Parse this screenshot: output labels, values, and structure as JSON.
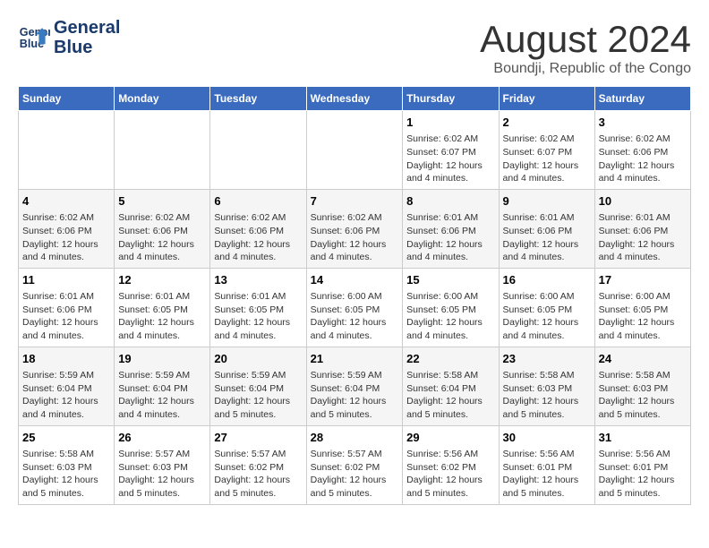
{
  "header": {
    "logo_line1": "General",
    "logo_line2": "Blue",
    "month_title": "August 2024",
    "subtitle": "Boundji, Republic of the Congo"
  },
  "weekdays": [
    "Sunday",
    "Monday",
    "Tuesday",
    "Wednesday",
    "Thursday",
    "Friday",
    "Saturday"
  ],
  "weeks": [
    [
      {
        "day": "",
        "info": ""
      },
      {
        "day": "",
        "info": ""
      },
      {
        "day": "",
        "info": ""
      },
      {
        "day": "",
        "info": ""
      },
      {
        "day": "1",
        "info": "Sunrise: 6:02 AM\nSunset: 6:07 PM\nDaylight: 12 hours\nand 4 minutes."
      },
      {
        "day": "2",
        "info": "Sunrise: 6:02 AM\nSunset: 6:07 PM\nDaylight: 12 hours\nand 4 minutes."
      },
      {
        "day": "3",
        "info": "Sunrise: 6:02 AM\nSunset: 6:06 PM\nDaylight: 12 hours\nand 4 minutes."
      }
    ],
    [
      {
        "day": "4",
        "info": "Sunrise: 6:02 AM\nSunset: 6:06 PM\nDaylight: 12 hours\nand 4 minutes."
      },
      {
        "day": "5",
        "info": "Sunrise: 6:02 AM\nSunset: 6:06 PM\nDaylight: 12 hours\nand 4 minutes."
      },
      {
        "day": "6",
        "info": "Sunrise: 6:02 AM\nSunset: 6:06 PM\nDaylight: 12 hours\nand 4 minutes."
      },
      {
        "day": "7",
        "info": "Sunrise: 6:02 AM\nSunset: 6:06 PM\nDaylight: 12 hours\nand 4 minutes."
      },
      {
        "day": "8",
        "info": "Sunrise: 6:01 AM\nSunset: 6:06 PM\nDaylight: 12 hours\nand 4 minutes."
      },
      {
        "day": "9",
        "info": "Sunrise: 6:01 AM\nSunset: 6:06 PM\nDaylight: 12 hours\nand 4 minutes."
      },
      {
        "day": "10",
        "info": "Sunrise: 6:01 AM\nSunset: 6:06 PM\nDaylight: 12 hours\nand 4 minutes."
      }
    ],
    [
      {
        "day": "11",
        "info": "Sunrise: 6:01 AM\nSunset: 6:06 PM\nDaylight: 12 hours\nand 4 minutes."
      },
      {
        "day": "12",
        "info": "Sunrise: 6:01 AM\nSunset: 6:05 PM\nDaylight: 12 hours\nand 4 minutes."
      },
      {
        "day": "13",
        "info": "Sunrise: 6:01 AM\nSunset: 6:05 PM\nDaylight: 12 hours\nand 4 minutes."
      },
      {
        "day": "14",
        "info": "Sunrise: 6:00 AM\nSunset: 6:05 PM\nDaylight: 12 hours\nand 4 minutes."
      },
      {
        "day": "15",
        "info": "Sunrise: 6:00 AM\nSunset: 6:05 PM\nDaylight: 12 hours\nand 4 minutes."
      },
      {
        "day": "16",
        "info": "Sunrise: 6:00 AM\nSunset: 6:05 PM\nDaylight: 12 hours\nand 4 minutes."
      },
      {
        "day": "17",
        "info": "Sunrise: 6:00 AM\nSunset: 6:05 PM\nDaylight: 12 hours\nand 4 minutes."
      }
    ],
    [
      {
        "day": "18",
        "info": "Sunrise: 5:59 AM\nSunset: 6:04 PM\nDaylight: 12 hours\nand 4 minutes."
      },
      {
        "day": "19",
        "info": "Sunrise: 5:59 AM\nSunset: 6:04 PM\nDaylight: 12 hours\nand 4 minutes."
      },
      {
        "day": "20",
        "info": "Sunrise: 5:59 AM\nSunset: 6:04 PM\nDaylight: 12 hours\nand 5 minutes."
      },
      {
        "day": "21",
        "info": "Sunrise: 5:59 AM\nSunset: 6:04 PM\nDaylight: 12 hours\nand 5 minutes."
      },
      {
        "day": "22",
        "info": "Sunrise: 5:58 AM\nSunset: 6:04 PM\nDaylight: 12 hours\nand 5 minutes."
      },
      {
        "day": "23",
        "info": "Sunrise: 5:58 AM\nSunset: 6:03 PM\nDaylight: 12 hours\nand 5 minutes."
      },
      {
        "day": "24",
        "info": "Sunrise: 5:58 AM\nSunset: 6:03 PM\nDaylight: 12 hours\nand 5 minutes."
      }
    ],
    [
      {
        "day": "25",
        "info": "Sunrise: 5:58 AM\nSunset: 6:03 PM\nDaylight: 12 hours\nand 5 minutes."
      },
      {
        "day": "26",
        "info": "Sunrise: 5:57 AM\nSunset: 6:03 PM\nDaylight: 12 hours\nand 5 minutes."
      },
      {
        "day": "27",
        "info": "Sunrise: 5:57 AM\nSunset: 6:02 PM\nDaylight: 12 hours\nand 5 minutes."
      },
      {
        "day": "28",
        "info": "Sunrise: 5:57 AM\nSunset: 6:02 PM\nDaylight: 12 hours\nand 5 minutes."
      },
      {
        "day": "29",
        "info": "Sunrise: 5:56 AM\nSunset: 6:02 PM\nDaylight: 12 hours\nand 5 minutes."
      },
      {
        "day": "30",
        "info": "Sunrise: 5:56 AM\nSunset: 6:01 PM\nDaylight: 12 hours\nand 5 minutes."
      },
      {
        "day": "31",
        "info": "Sunrise: 5:56 AM\nSunset: 6:01 PM\nDaylight: 12 hours\nand 5 minutes."
      }
    ]
  ]
}
